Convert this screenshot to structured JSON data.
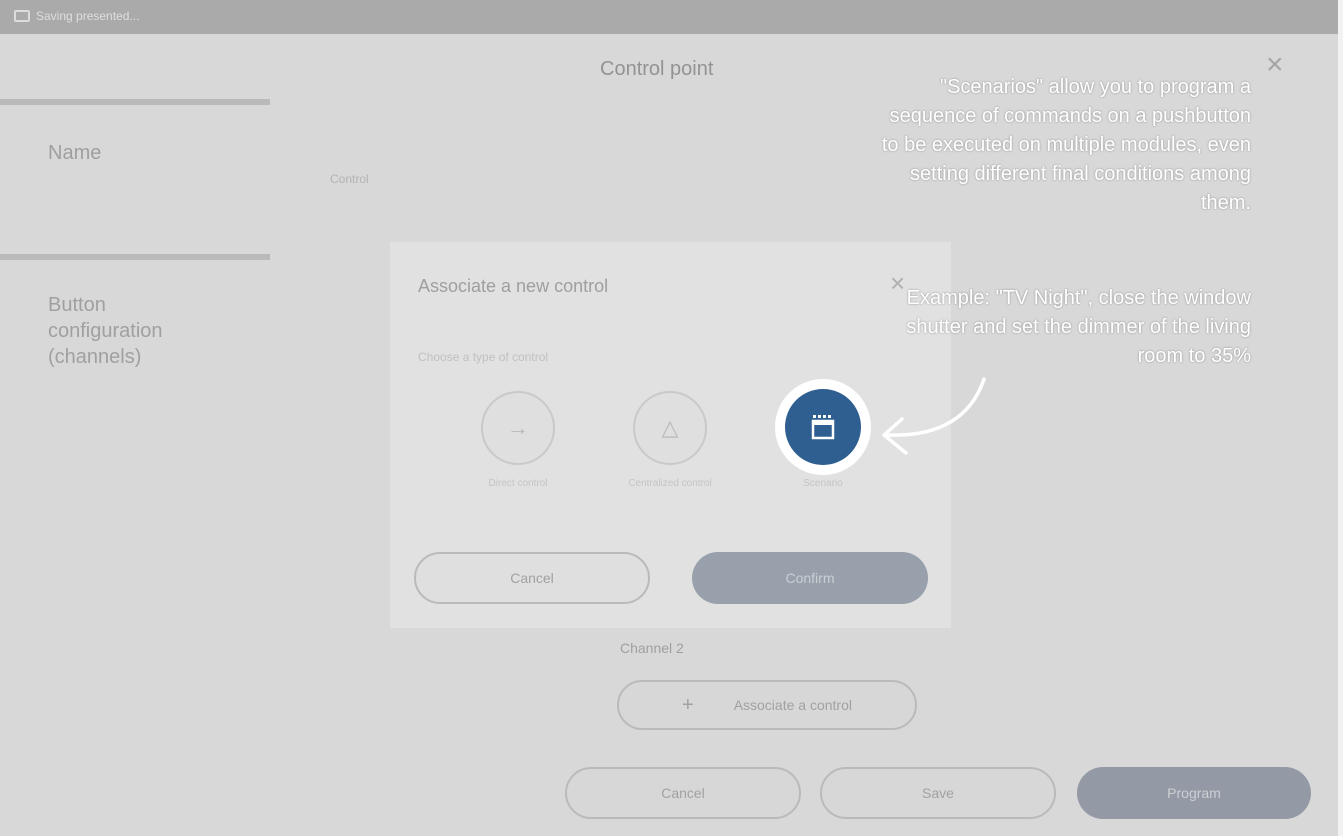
{
  "window": {
    "title": "Saving presented..."
  },
  "main": {
    "title": "Control point",
    "close_glyph": "×",
    "sidebar": {
      "name_label": "Name",
      "button_config_label_1": "Button",
      "button_config_label_2": "configuration",
      "button_config_label_3": "(channels)"
    },
    "name_field_hint": "Control",
    "channel_label": "Channel 2",
    "associate_button": "Associate a control",
    "plus_glyph": "+",
    "footer": {
      "cancel": "Cancel",
      "save": "Save",
      "program": "Program"
    }
  },
  "dialog": {
    "title": "Associate a new control",
    "close_glyph": "×",
    "subtitle": "Choose a type of control",
    "options": [
      {
        "label": "Direct control",
        "glyph": "→"
      },
      {
        "label": "Centralized control",
        "glyph": "△"
      },
      {
        "label": "Scenario"
      }
    ],
    "cancel": "Cancel",
    "confirm": "Confirm"
  },
  "tutorial": {
    "text_lines": [
      "\"Scenarios\" allow you to program a",
      "sequence of commands on a pushbutton",
      "to be executed on multiple modules, even",
      "setting different final conditions among",
      "them."
    ],
    "example_lines": [
      "Example: \"TV Night\", close the window",
      "shutter and set the dimmer of the living",
      "room to 35%"
    ]
  },
  "colors": {
    "accent": "#2f5f90",
    "ring": "#ffffff"
  }
}
